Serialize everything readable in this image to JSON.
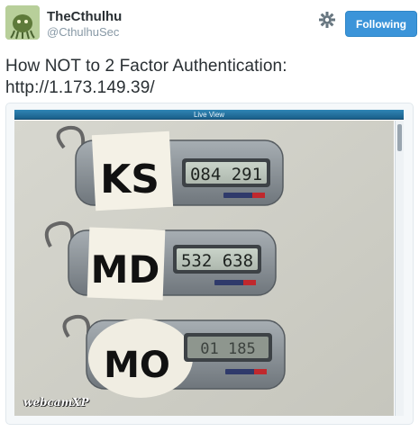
{
  "user": {
    "display_name": "TheCthulhu",
    "handle": "@CthulhuSec"
  },
  "header": {
    "follow_label": "Following",
    "settings_icon": "gear-icon"
  },
  "tweet": {
    "text_line1": "How NOT to 2 Factor Authentication:",
    "text_line2": "http://1.173.149.39/"
  },
  "media": {
    "window_title": "Live View",
    "watermark": "webcamXP",
    "tokens": [
      {
        "label": "KS",
        "code": "084 291"
      },
      {
        "label": "MD",
        "code": "532 638"
      },
      {
        "label": "MO",
        "code": "01 185"
      }
    ]
  }
}
